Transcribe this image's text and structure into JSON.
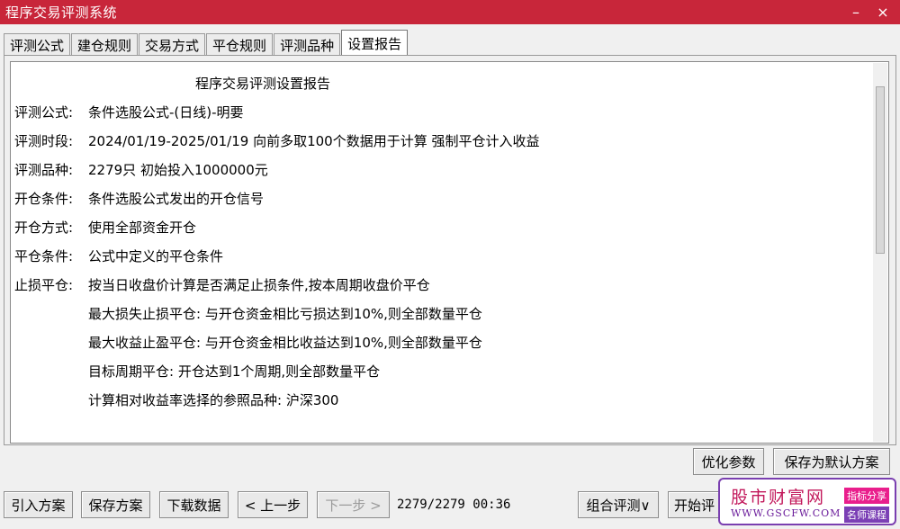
{
  "window": {
    "title": "程序交易评测系统",
    "minimize": "–",
    "close": "×"
  },
  "tabs": [
    "评测公式",
    "建仓规则",
    "交易方式",
    "平仓规则",
    "评测品种",
    "设置报告"
  ],
  "report": {
    "heading": "程序交易评测设置报告",
    "rows": [
      {
        "k": "评测公式:",
        "v": "条件选股公式-(日线)-明要"
      },
      {
        "k": "评测时段:",
        "v": "2024/01/19-2025/01/19 向前多取100个数据用于计算 强制平仓计入收益"
      },
      {
        "k": "评测品种:",
        "v": "2279只 初始投入1000000元"
      },
      {
        "k": "开仓条件:",
        "v": "条件选股公式发出的开仓信号"
      },
      {
        "k": "开仓方式:",
        "v": "使用全部资金开仓"
      },
      {
        "k": "平仓条件:",
        "v": "公式中定义的平仓条件"
      },
      {
        "k": "止损平仓:",
        "v": "按当日收盘价计算是否满足止损条件,按本周期收盘价平仓"
      }
    ],
    "subs": [
      "最大损失止损平仓: 与开仓资金相比亏损达到10%,则全部数量平仓",
      "最大收益止盈平仓: 与开仓资金相比收益达到10%,则全部数量平仓",
      "目标周期平仓: 开仓达到1个周期,则全部数量平仓",
      "计算相对收益率选择的参照品种: 沪深300"
    ]
  },
  "buttons": {
    "optimize": "优化参数",
    "save_default": "保存为默认方案",
    "import": "引入方案",
    "save": "保存方案",
    "download": "下载数据",
    "prev": "< 上一步",
    "next": "下一步 >",
    "combo": "组合评测∨",
    "start": "开始评"
  },
  "status": "2279/2279 00:36",
  "watermark": {
    "brand": "股市财富网",
    "url": "WWW.GSCFW.COM",
    "tag1": "指标分享",
    "tag2": "名师课程"
  }
}
